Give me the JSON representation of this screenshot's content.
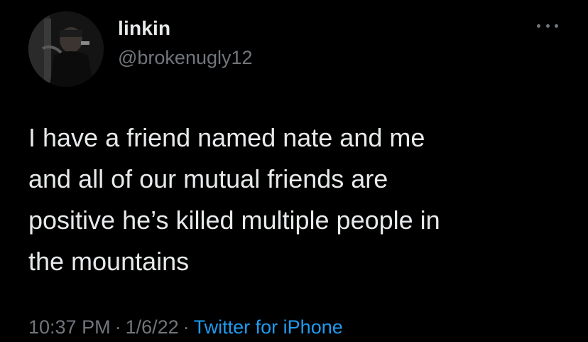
{
  "author": {
    "display_name": "linkin",
    "handle": "@brokenugly12"
  },
  "more_icon": "more-horizontal-icon",
  "tweet_text_lines": [
    "I have a friend named nate and me",
    "and all of our mutual friends are",
    "positive he’s killed multiple people in",
    "the mountains"
  ],
  "meta": {
    "time": "10:37 PM",
    "separator": "·",
    "date": "1/6/22",
    "source": "Twitter for iPhone"
  },
  "colors": {
    "background": "#000000",
    "primary_text": "#e7e9ea",
    "secondary_text": "#71767b",
    "link": "#1d9bf0"
  }
}
